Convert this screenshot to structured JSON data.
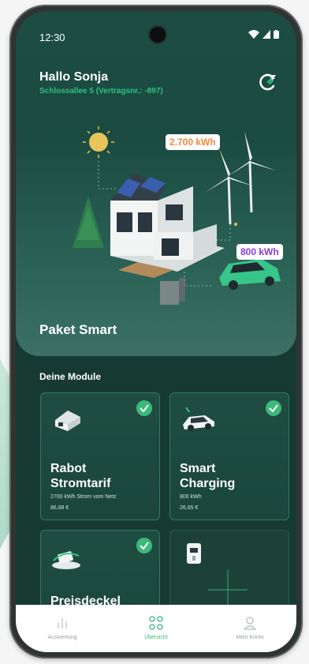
{
  "status": {
    "time": "12:30"
  },
  "header": {
    "greeting": "Hallo Sonja",
    "address": "Schlossallee 5 (Vertragsnr.: -897)"
  },
  "hero": {
    "energy_badge": "2.700 kWh",
    "car_badge": "800 kWh",
    "package_title": "Paket Smart"
  },
  "modules": {
    "title": "Deine Module",
    "items": [
      {
        "title_line1": "Rabot",
        "title_line2": "Stromtarif",
        "subtitle": "2700 kWh Strom vom Netz",
        "price": "86,88 €",
        "active": true
      },
      {
        "title_line1": "Smart",
        "title_line2": "Charging",
        "subtitle": "800 kWh",
        "price": "26,65 €",
        "active": true
      },
      {
        "title_line1": "Preisdeckel",
        "title_line2": "",
        "subtitle": "",
        "price": "",
        "active": true
      },
      {
        "title_line1": "",
        "title_line2": "",
        "subtitle": "",
        "price": "",
        "active": false
      }
    ]
  },
  "tabbar": {
    "tabs": [
      {
        "label": "Auswertung",
        "icon": "bar-chart-icon",
        "active": false
      },
      {
        "label": "Übersicht",
        "icon": "grid-icon",
        "active": true
      },
      {
        "label": "Mein Konto",
        "icon": "user-icon",
        "active": false
      }
    ]
  },
  "colors": {
    "accent": "#3cb97a",
    "background": "#163a32",
    "energy": "#f08a3a",
    "car": "#8b3bd6"
  }
}
